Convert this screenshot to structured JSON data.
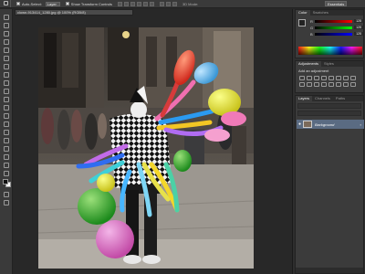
{
  "options_bar": {
    "auto_select_label": "Auto-Select:",
    "auto_select_target": "Layer",
    "show_transform_label": "Show Transform Controls",
    "mode_3d_label": "3D Mode:",
    "workspace": "Essentials"
  },
  "document": {
    "tab_title": "clown-913414_1280.jpg @ 100% (RGB/8)"
  },
  "color_panel": {
    "tabs": [
      "Color",
      "Swatches"
    ],
    "channels": [
      {
        "label": "R",
        "value": "128"
      },
      {
        "label": "G",
        "value": "128"
      },
      {
        "label": "B",
        "value": "128"
      }
    ]
  },
  "adjustments_panel": {
    "tabs": [
      "Adjustments",
      "Styles"
    ],
    "title": "Add an adjustment"
  },
  "layers_panel": {
    "tabs": [
      "Layers",
      "Channels",
      "Paths"
    ],
    "layer_name": "Background"
  },
  "colors": {
    "ui_dark": "#282828",
    "panel": "#3b3b3b",
    "layer_selected": "#5a6b82"
  }
}
